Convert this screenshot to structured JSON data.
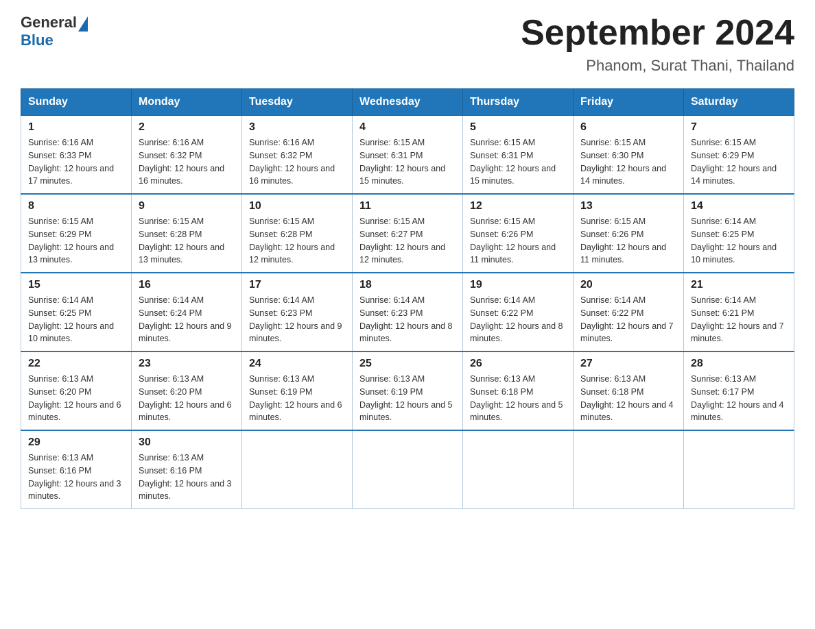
{
  "header": {
    "logo_general": "General",
    "logo_blue": "Blue",
    "title": "September 2024",
    "subtitle": "Phanom, Surat Thani, Thailand"
  },
  "days_of_week": [
    "Sunday",
    "Monday",
    "Tuesday",
    "Wednesday",
    "Thursday",
    "Friday",
    "Saturday"
  ],
  "weeks": [
    [
      {
        "day": "1",
        "sunrise": "6:16 AM",
        "sunset": "6:33 PM",
        "daylight": "12 hours and 17 minutes."
      },
      {
        "day": "2",
        "sunrise": "6:16 AM",
        "sunset": "6:32 PM",
        "daylight": "12 hours and 16 minutes."
      },
      {
        "day": "3",
        "sunrise": "6:16 AM",
        "sunset": "6:32 PM",
        "daylight": "12 hours and 16 minutes."
      },
      {
        "day": "4",
        "sunrise": "6:15 AM",
        "sunset": "6:31 PM",
        "daylight": "12 hours and 15 minutes."
      },
      {
        "day": "5",
        "sunrise": "6:15 AM",
        "sunset": "6:31 PM",
        "daylight": "12 hours and 15 minutes."
      },
      {
        "day": "6",
        "sunrise": "6:15 AM",
        "sunset": "6:30 PM",
        "daylight": "12 hours and 14 minutes."
      },
      {
        "day": "7",
        "sunrise": "6:15 AM",
        "sunset": "6:29 PM",
        "daylight": "12 hours and 14 minutes."
      }
    ],
    [
      {
        "day": "8",
        "sunrise": "6:15 AM",
        "sunset": "6:29 PM",
        "daylight": "12 hours and 13 minutes."
      },
      {
        "day": "9",
        "sunrise": "6:15 AM",
        "sunset": "6:28 PM",
        "daylight": "12 hours and 13 minutes."
      },
      {
        "day": "10",
        "sunrise": "6:15 AM",
        "sunset": "6:28 PM",
        "daylight": "12 hours and 12 minutes."
      },
      {
        "day": "11",
        "sunrise": "6:15 AM",
        "sunset": "6:27 PM",
        "daylight": "12 hours and 12 minutes."
      },
      {
        "day": "12",
        "sunrise": "6:15 AM",
        "sunset": "6:26 PM",
        "daylight": "12 hours and 11 minutes."
      },
      {
        "day": "13",
        "sunrise": "6:15 AM",
        "sunset": "6:26 PM",
        "daylight": "12 hours and 11 minutes."
      },
      {
        "day": "14",
        "sunrise": "6:14 AM",
        "sunset": "6:25 PM",
        "daylight": "12 hours and 10 minutes."
      }
    ],
    [
      {
        "day": "15",
        "sunrise": "6:14 AM",
        "sunset": "6:25 PM",
        "daylight": "12 hours and 10 minutes."
      },
      {
        "day": "16",
        "sunrise": "6:14 AM",
        "sunset": "6:24 PM",
        "daylight": "12 hours and 9 minutes."
      },
      {
        "day": "17",
        "sunrise": "6:14 AM",
        "sunset": "6:23 PM",
        "daylight": "12 hours and 9 minutes."
      },
      {
        "day": "18",
        "sunrise": "6:14 AM",
        "sunset": "6:23 PM",
        "daylight": "12 hours and 8 minutes."
      },
      {
        "day": "19",
        "sunrise": "6:14 AM",
        "sunset": "6:22 PM",
        "daylight": "12 hours and 8 minutes."
      },
      {
        "day": "20",
        "sunrise": "6:14 AM",
        "sunset": "6:22 PM",
        "daylight": "12 hours and 7 minutes."
      },
      {
        "day": "21",
        "sunrise": "6:14 AM",
        "sunset": "6:21 PM",
        "daylight": "12 hours and 7 minutes."
      }
    ],
    [
      {
        "day": "22",
        "sunrise": "6:13 AM",
        "sunset": "6:20 PM",
        "daylight": "12 hours and 6 minutes."
      },
      {
        "day": "23",
        "sunrise": "6:13 AM",
        "sunset": "6:20 PM",
        "daylight": "12 hours and 6 minutes."
      },
      {
        "day": "24",
        "sunrise": "6:13 AM",
        "sunset": "6:19 PM",
        "daylight": "12 hours and 6 minutes."
      },
      {
        "day": "25",
        "sunrise": "6:13 AM",
        "sunset": "6:19 PM",
        "daylight": "12 hours and 5 minutes."
      },
      {
        "day": "26",
        "sunrise": "6:13 AM",
        "sunset": "6:18 PM",
        "daylight": "12 hours and 5 minutes."
      },
      {
        "day": "27",
        "sunrise": "6:13 AM",
        "sunset": "6:18 PM",
        "daylight": "12 hours and 4 minutes."
      },
      {
        "day": "28",
        "sunrise": "6:13 AM",
        "sunset": "6:17 PM",
        "daylight": "12 hours and 4 minutes."
      }
    ],
    [
      {
        "day": "29",
        "sunrise": "6:13 AM",
        "sunset": "6:16 PM",
        "daylight": "12 hours and 3 minutes."
      },
      {
        "day": "30",
        "sunrise": "6:13 AM",
        "sunset": "6:16 PM",
        "daylight": "12 hours and 3 minutes."
      },
      null,
      null,
      null,
      null,
      null
    ]
  ]
}
